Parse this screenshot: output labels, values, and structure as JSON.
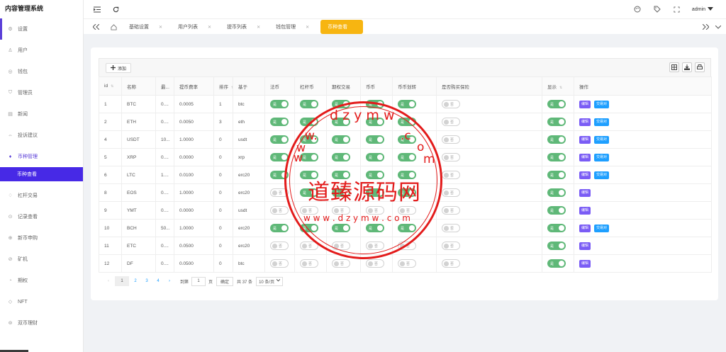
{
  "app": {
    "title": "内容管理系统"
  },
  "sidebar": {
    "items": [
      {
        "label": "设置",
        "icon": "gear-icon"
      },
      {
        "label": "用户",
        "icon": "user-icon"
      },
      {
        "label": "钱包",
        "icon": "wallet-icon"
      },
      {
        "label": "管理员",
        "icon": "shield-icon"
      },
      {
        "label": "新闻",
        "icon": "news-icon"
      },
      {
        "label": "投诉建议",
        "icon": "link-icon"
      },
      {
        "label": "币种管理",
        "icon": "diamond-icon"
      },
      {
        "label": "杠杆交易",
        "icon": "diamond-outline-icon"
      },
      {
        "label": "记录查看",
        "icon": "record-icon"
      },
      {
        "label": "新币申购",
        "icon": "coin-icon"
      },
      {
        "label": "矿机",
        "icon": "miner-icon"
      },
      {
        "label": "期权",
        "icon": "option-icon"
      },
      {
        "label": "NFT",
        "icon": "nft-icon"
      },
      {
        "label": "双币理财",
        "icon": "finance-icon"
      }
    ],
    "active_submenu": "币种查看"
  },
  "header": {
    "user": "admin"
  },
  "tabs": [
    {
      "label": "基础设置"
    },
    {
      "label": "用户列表"
    },
    {
      "label": "提币列表"
    },
    {
      "label": "钱包管理"
    },
    {
      "label": "币种查看"
    }
  ],
  "toolbar": {
    "add_label": "添加"
  },
  "table": {
    "headers": [
      "id",
      "名称",
      "最...",
      "提币费率",
      "排序",
      "基于",
      "法币",
      "杠杆币",
      "期权交易",
      "币币",
      "币币划转",
      "是否购买保险",
      "显示",
      "操作"
    ],
    "switch_on": "是",
    "switch_off": "否",
    "edit_label": "编辑",
    "trade_label": "交易对",
    "rows": [
      {
        "id": "1",
        "name": "BTC",
        "min": "0....",
        "fee": "0.0005",
        "sort": "1",
        "base": "btc",
        "fiat": true,
        "lever": true,
        "option": true,
        "coin": true,
        "transfer": true,
        "insure": false,
        "show": true,
        "trade": true
      },
      {
        "id": "2",
        "name": "ETH",
        "min": "0....",
        "fee": "0.0050",
        "sort": "3",
        "base": "eth",
        "fiat": true,
        "lever": true,
        "option": true,
        "coin": true,
        "transfer": true,
        "insure": false,
        "show": true,
        "trade": true
      },
      {
        "id": "4",
        "name": "USDT",
        "min": "10...",
        "fee": "1.0000",
        "sort": "0",
        "base": "usdt",
        "fiat": true,
        "lever": true,
        "option": true,
        "coin": true,
        "transfer": true,
        "insure": false,
        "show": true,
        "trade": true
      },
      {
        "id": "5",
        "name": "XRP",
        "min": "0....",
        "fee": "0.0000",
        "sort": "0",
        "base": "xrp",
        "fiat": true,
        "lever": true,
        "option": true,
        "coin": true,
        "transfer": true,
        "insure": false,
        "show": true,
        "trade": true
      },
      {
        "id": "6",
        "name": "LTC",
        "min": "1....",
        "fee": "0.0100",
        "sort": "0",
        "base": "erc20",
        "fiat": true,
        "lever": true,
        "option": true,
        "coin": true,
        "transfer": true,
        "insure": false,
        "show": true,
        "trade": true
      },
      {
        "id": "8",
        "name": "EOS",
        "min": "0....",
        "fee": "1.0000",
        "sort": "0",
        "base": "erc20",
        "fiat": false,
        "lever": true,
        "option": true,
        "coin": true,
        "transfer": true,
        "insure": false,
        "show": true,
        "trade": false
      },
      {
        "id": "9",
        "name": "YMT",
        "min": "0....",
        "fee": "0.0000",
        "sort": "0",
        "base": "usdt",
        "fiat": false,
        "lever": false,
        "option": false,
        "coin": false,
        "transfer": false,
        "insure": false,
        "show": true,
        "trade": false
      },
      {
        "id": "10",
        "name": "BCH",
        "min": "50...",
        "fee": "1.0000",
        "sort": "0",
        "base": "erc20",
        "fiat": true,
        "lever": true,
        "option": true,
        "coin": true,
        "transfer": true,
        "insure": false,
        "show": true,
        "trade": true
      },
      {
        "id": "11",
        "name": "ETC",
        "min": "0....",
        "fee": "0.0500",
        "sort": "0",
        "base": "erc20",
        "fiat": false,
        "lever": false,
        "option": false,
        "coin": false,
        "transfer": false,
        "insure": false,
        "show": true,
        "trade": false
      },
      {
        "id": "12",
        "name": "DF",
        "min": "0....",
        "fee": "0.0500",
        "sort": "0",
        "base": "btc",
        "fiat": false,
        "lever": false,
        "option": false,
        "coin": false,
        "transfer": false,
        "insure": false,
        "show": true,
        "trade": false
      }
    ]
  },
  "pager": {
    "pages": [
      "1",
      "2",
      "3",
      "4"
    ],
    "goto_label": "到第",
    "goto_value": "1",
    "page_unit": "页",
    "confirm": "确定",
    "total": "共 37 条",
    "per_page": "10 条/页"
  },
  "watermark": {
    "text": "道臻源码网",
    "url_text": "www.dzymw.com"
  }
}
